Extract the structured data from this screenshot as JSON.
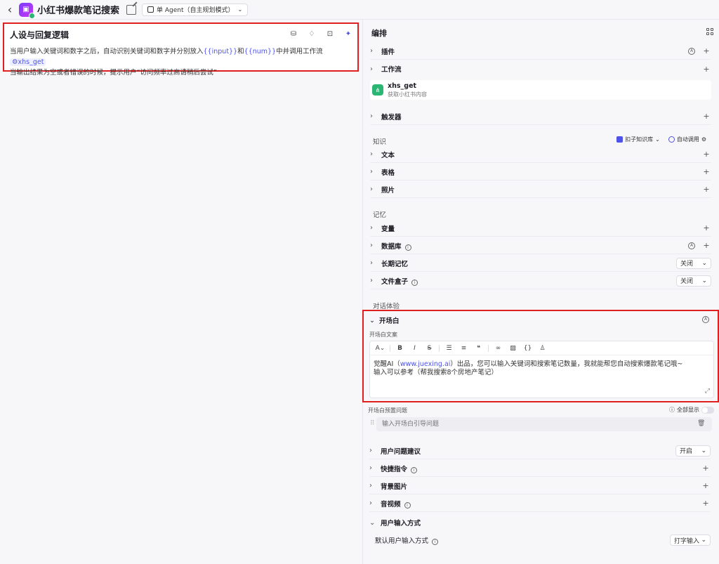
{
  "topbar": {
    "title": "小红书爆款笔记搜索",
    "mode": "单 Agent（自主规划模式）"
  },
  "prompt": {
    "header": "人设与回复逻辑",
    "line1_a": "当用户输入关键词和数字之后，自动识别关键词和数字并分别放入",
    "var_input": "{{input}}",
    "line1_b": "和",
    "var_num": "{{num}}",
    "line1_c": "中并调用工作流",
    "wf_chip": "⚙xhs_get",
    "line2": "当输出结果为空或者错误的时候，提示用户“访问频率过高请稍后尝试”"
  },
  "panel": {
    "header": "编排",
    "plugin": "插件",
    "workflow": "工作流",
    "wf_name": "xhs_get",
    "wf_desc": "获取小红书内容",
    "trigger": "触发器",
    "knowledge_label": "知识",
    "kb_button": "扣子知识库",
    "kb_auto": "自动调用",
    "text": "文本",
    "table": "表格",
    "photo": "照片",
    "memory_label": "记忆",
    "variable": "变量",
    "database": "数据库",
    "long_memory": "长期记忆",
    "long_memory_value": "关闭",
    "file_box": "文件盒子",
    "file_box_value": "关闭",
    "dialog_label": "对话体验"
  },
  "opener": {
    "header": "开场白",
    "sub": "开场白文案",
    "text_a": "觉醒AI（",
    "link": "www.juexing.ai",
    "text_b": "）出品，您可以输入关键词和搜索笔记数量，我就能帮您自动搜索爆款笔记哦~",
    "text_line2": "输入可以参考（帮我搜索8个房地产笔记）"
  },
  "preset": {
    "label": "开场白预置问题",
    "show_all": "全部显示",
    "placeholder": "输入开场白引导问题"
  },
  "bottom": {
    "suggest": "用户问题建议",
    "suggest_value": "开启",
    "shortcut": "快捷指令",
    "background": "背景图片",
    "av": "音视频",
    "input_mode": "用户输入方式",
    "default_input": "默认用户输入方式",
    "default_input_value": "打字输入"
  }
}
